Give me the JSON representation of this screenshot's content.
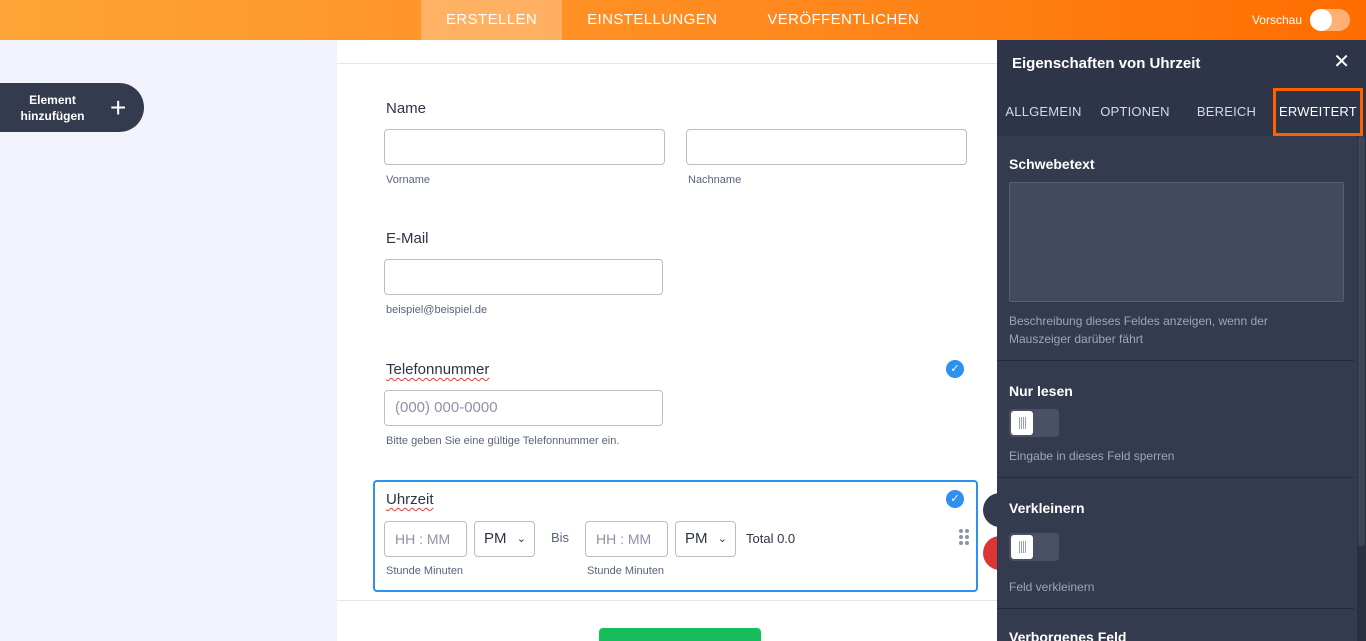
{
  "topnav": {
    "tabs": [
      {
        "label": "ERSTELLEN",
        "active": true
      },
      {
        "label": "EINSTELLUNGEN",
        "active": false
      },
      {
        "label": "VERÖFFENTLICHEN",
        "active": false
      }
    ],
    "preview_label": "Vorschau"
  },
  "sidebar": {
    "add_element_line1": "Element",
    "add_element_line2": "hinzufügen",
    "add_icon": "plus-icon"
  },
  "form": {
    "name": {
      "label": "Name",
      "first_sublabel": "Vorname",
      "last_sublabel": "Nachname"
    },
    "email": {
      "label": "E-Mail",
      "sublabel": "beispiel@beispiel.de"
    },
    "phone": {
      "label": "Telefonnummer",
      "placeholder": "(000) 000-0000",
      "sublabel": "Bitte geben Sie eine gültige Telefonnummer ein."
    },
    "time": {
      "label": "Uhrzeit",
      "from_placeholder": "HH : MM",
      "from_ampm": "PM",
      "between": "Bis",
      "to_placeholder": "HH : MM",
      "to_ampm": "PM",
      "total": "Total 0.0",
      "from_sublabel": "Stunde Minuten",
      "to_sublabel": "Stunde Minuten"
    }
  },
  "panel": {
    "title": "Eigenschaften von Uhrzeit",
    "tabs": [
      {
        "label": "ALLGEMEIN",
        "active": false
      },
      {
        "label": "OPTIONEN",
        "active": false
      },
      {
        "label": "BEREICH",
        "active": false
      },
      {
        "label": "ERWEITERT",
        "active": true
      }
    ],
    "hover_text": {
      "title": "Schwebetext",
      "desc": "Beschreibung dieses Feldes anzeigen, wenn der Mauszeiger darüber fährt"
    },
    "read_only": {
      "title": "Nur lesen",
      "desc": "Eingabe in dieses Feld sperren",
      "enabled": false
    },
    "shrink": {
      "title": "Verkleinern",
      "desc": "Feld verkleinern",
      "enabled": false
    },
    "hidden": {
      "title": "Verborgenes Feld"
    }
  },
  "colors": {
    "accent": "#ff6100",
    "selected": "#2e91f0",
    "panel_bg": "#343b4e",
    "submit": "#18bd5b"
  }
}
